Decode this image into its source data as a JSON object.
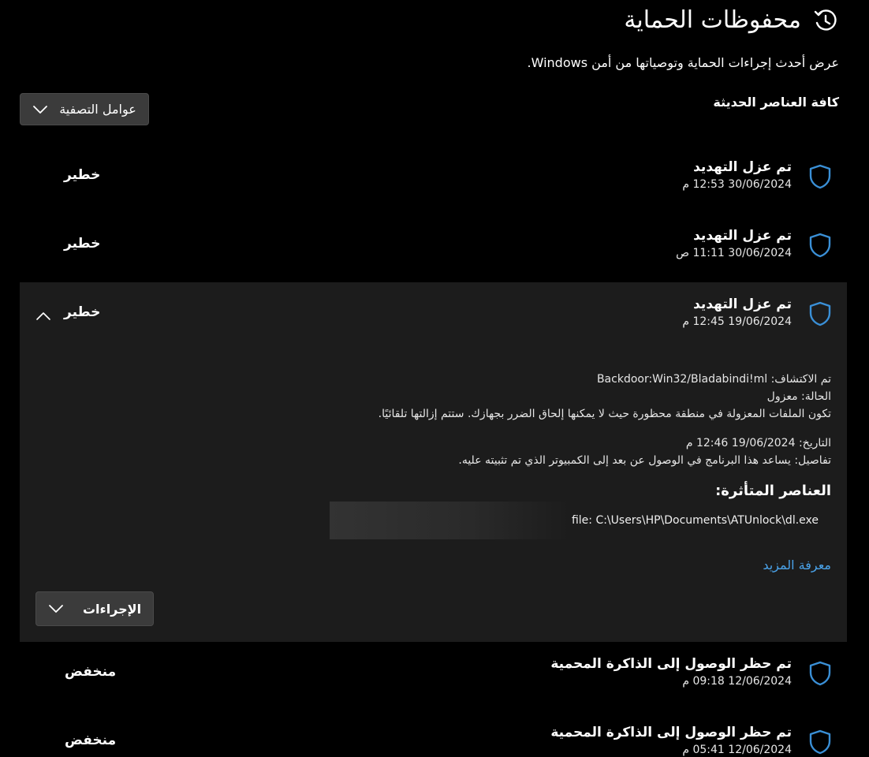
{
  "header": {
    "title": "محفوظات الحماية",
    "subtitle": "عرض أحدث إجراءات الحماية وتوصياتها من أمن Windows."
  },
  "section_label": "كافة العناصر الحديثة",
  "filter_button": {
    "label": "عوامل التصفية"
  },
  "items": [
    {
      "title": "تم عزل التهديد",
      "time": "30/06/2024 12:53 م",
      "severity": "خطير"
    },
    {
      "title": "تم عزل التهديد",
      "time": "30/06/2024 11:11 ص",
      "severity": "خطير"
    },
    {
      "title": "تم عزل التهديد",
      "time": "19/06/2024 12:45 م",
      "severity": "خطير",
      "details": {
        "detected_label": "تم الاكتشاف:",
        "detected_value": "Backdoor:Win32/Bladabindi!ml",
        "status_label": "الحالة:",
        "status_value": "معزول",
        "status_description": "تكون الملفات المعزولة في منطقة محظورة حيث لا يمكنها إلحاق الضرر بجهازك. ستتم إزالتها تلقائيًا.",
        "date_label": "التاريخ:",
        "date_value": "19/06/2024 12:46 م",
        "details_label": "تفاصيل:",
        "details_value": "يساعد هذا البرنامج في الوصول عن بعد إلى الكمبيوتر الذي تم تثبيته عليه.",
        "affected_title": "العناصر المتأثرة:",
        "affected_file": "file: C:\\Users\\HP\\Documents\\ATUnlock\\dl.exe",
        "learn_more": "معرفة المزيد",
        "actions_label": "الإجراءات"
      }
    },
    {
      "title": "تم حظر الوصول إلى الذاكرة المحمية",
      "time": "12/06/2024 09:18 م",
      "severity": "منخفض"
    },
    {
      "title": "تم حظر الوصول إلى الذاكرة المحمية",
      "time": "12/06/2024 05:41 م",
      "severity": "منخفض"
    }
  ],
  "colors": {
    "background": "#000000",
    "expanded_background": "#1c1c1c",
    "shield_blue": "#3a8fd6",
    "link_blue": "#4aa3ea",
    "button_bg": "#3b3b3b"
  },
  "icons": {
    "header": "history-icon",
    "item": "shield-icon",
    "dropdown": "chevron-down-icon",
    "collapse": "chevron-up-icon"
  }
}
